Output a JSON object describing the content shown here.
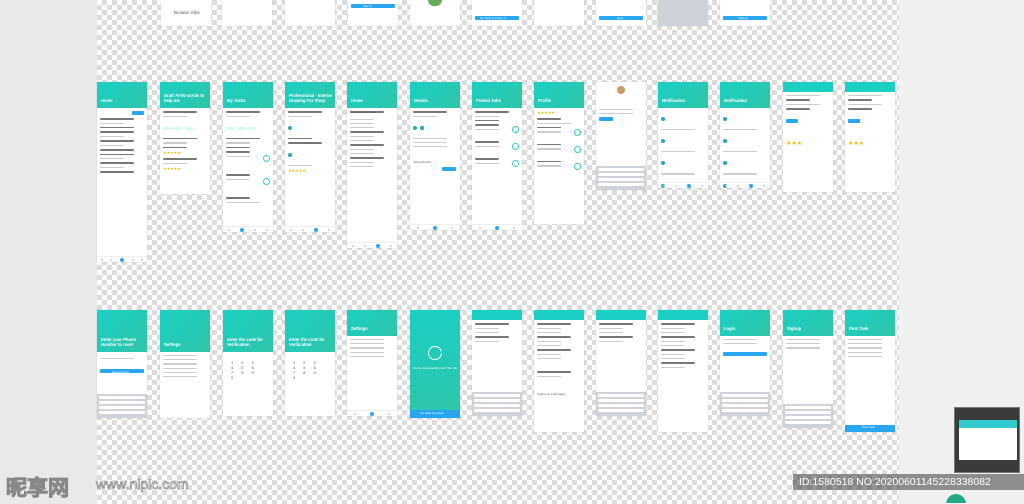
{
  "screens_top_row": {
    "browse_jobs_label": "Browse Jobs",
    "sign_in_label": "Sign in",
    "go_back_label": "Go back to home ➔",
    "next_label": "Next",
    "upload_label": "Upload"
  },
  "screens_mid_row": {
    "home_title": "Home",
    "my_tasks_title": "My Tasks",
    "home2_title": "Home",
    "details_title": "Details",
    "posted_jobs_title": "Posted Jobs",
    "profile_title": "Profile",
    "notification_title": "Notification",
    "notification2_title": "Notification",
    "task_posted_text": "Professional - Interior Drawing For Shop",
    "draft_text": "Draft 70-90 words to help me",
    "create_logo_text": "Create logo for new",
    "typing_text": "Typing up a 11 pages",
    "job_posted_by": "Job posted by"
  },
  "screens_bottom_row": {
    "enter_phone_title": "Enter your Phone Number to reset",
    "settings_title": "Settings",
    "enter_code_title": "Enter the code for Verification",
    "enter_code2_title": "Enter the code for Verification",
    "settings2_title": "Settings",
    "success_text": "You've successfully post This Job",
    "login_title": "Login",
    "signup_title": "Signup",
    "post_task_title": "Post Task",
    "reset_button": "Reset Action",
    "login_button": "Login",
    "go_back_button": "Go back to Home",
    "post_button": "Post Task"
  },
  "watermark": {
    "brand": "昵享网",
    "url": "www.nipic.com",
    "id_line": "ID:1580518 NO:20200601145228338082"
  },
  "colors": {
    "accent_teal": "#1bcfc4",
    "accent_blue": "#29a6f0",
    "star": "#f5b800"
  }
}
